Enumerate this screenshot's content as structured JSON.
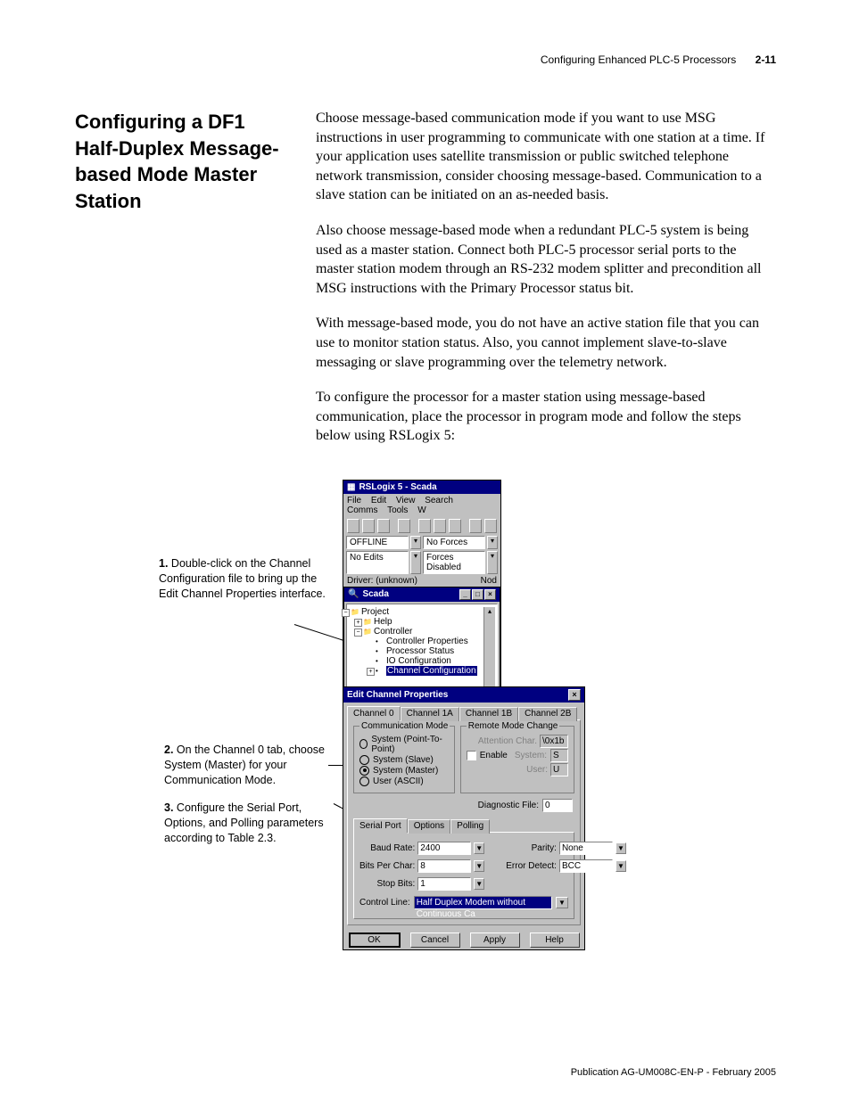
{
  "header": {
    "title": "Configuring Enhanced PLC-5 Processors",
    "page": "2-11"
  },
  "sidehead": "Configuring a DF1 Half-Duplex Message-based Mode Master Station",
  "paragraphs": [
    "Choose message-based communication mode if you want to use MSG instructions in user programming to communicate with one station at a time. If your application uses satellite transmission or public switched telephone network transmission, consider choosing message-based. Communication to a slave station can be initiated on an as-needed basis.",
    "Also choose message-based mode when a redundant PLC-5 system is being used as a master station. Connect both PLC-5 processor serial ports to the master station modem through an RS-232 modem splitter and precondition all MSG instructions with the Primary Processor status bit.",
    "With message-based mode, you do not have an active station file that you can use to monitor station status. Also, you cannot implement slave-to-slave messaging or slave programming over the telemetry network.",
    "To configure the processor for a master station using message-based communication, place the processor in program mode and follow the steps below using RSLogix 5:"
  ],
  "annotations": {
    "a1_num": "1.",
    "a1_text": "Double-click on the Channel Configuration file to bring up the Edit Channel Properties interface.",
    "a2_num": "2.",
    "a2_text": "On the Channel 0 tab, choose System (Master) for your Communication Mode.",
    "a3_num": "3.",
    "a3_text": "Configure the Serial Port, Options, and Polling parameters according to Table 2.3."
  },
  "win1": {
    "title": "RSLogix 5 - Scada",
    "menus": [
      "File",
      "Edit",
      "View",
      "Search",
      "Comms",
      "Tools",
      "W"
    ],
    "status1a": "OFFLINE",
    "status1b": "No Forces",
    "status2a": "No Edits",
    "status2b": "Forces Disabled",
    "driver": "Driver: (unknown)",
    "node": "Nod",
    "sub_title": "Scada",
    "tree": {
      "root": "Project",
      "help": "Help",
      "controller": "Controller",
      "props": "Controller Properties",
      "pstat": "Processor Status",
      "io": "IO Configuration",
      "chan": "Channel Configuration"
    }
  },
  "dialog": {
    "title": "Edit Channel Properties",
    "tabs": [
      "Channel 0",
      "Channel 1A",
      "Channel 1B",
      "Channel 2B"
    ],
    "comm_legend": "Communication Mode",
    "comm_opts": [
      "System (Point-To-Point)",
      "System (Slave)",
      "System (Master)",
      "User (ASCII)"
    ],
    "remote_legend": "Remote Mode Change",
    "attn_lbl": "Attention Char.",
    "attn_val": "\\0x1b",
    "enable": "Enable",
    "system_lbl": "System:",
    "system_val": "S",
    "user_lbl": "User:",
    "user_val": "U",
    "diag_lbl": "Diagnostic File:",
    "diag_val": "0",
    "subtabs": [
      "Serial Port",
      "Options",
      "Polling"
    ],
    "baud_lbl": "Baud Rate:",
    "baud_val": "2400",
    "parity_lbl": "Parity:",
    "parity_val": "None",
    "bpc_lbl": "Bits Per Char:",
    "bpc_val": "8",
    "err_lbl": "Error Detect:",
    "err_val": "BCC",
    "stop_lbl": "Stop Bits:",
    "stop_val": "1",
    "ctl_lbl": "Control Line:",
    "ctl_val": "Half Duplex Modem without Continuous Ca",
    "ok": "OK",
    "cancel": "Cancel",
    "apply": "Apply",
    "help": "Help"
  },
  "footer": "Publication AG-UM008C-EN-P - February 2005"
}
